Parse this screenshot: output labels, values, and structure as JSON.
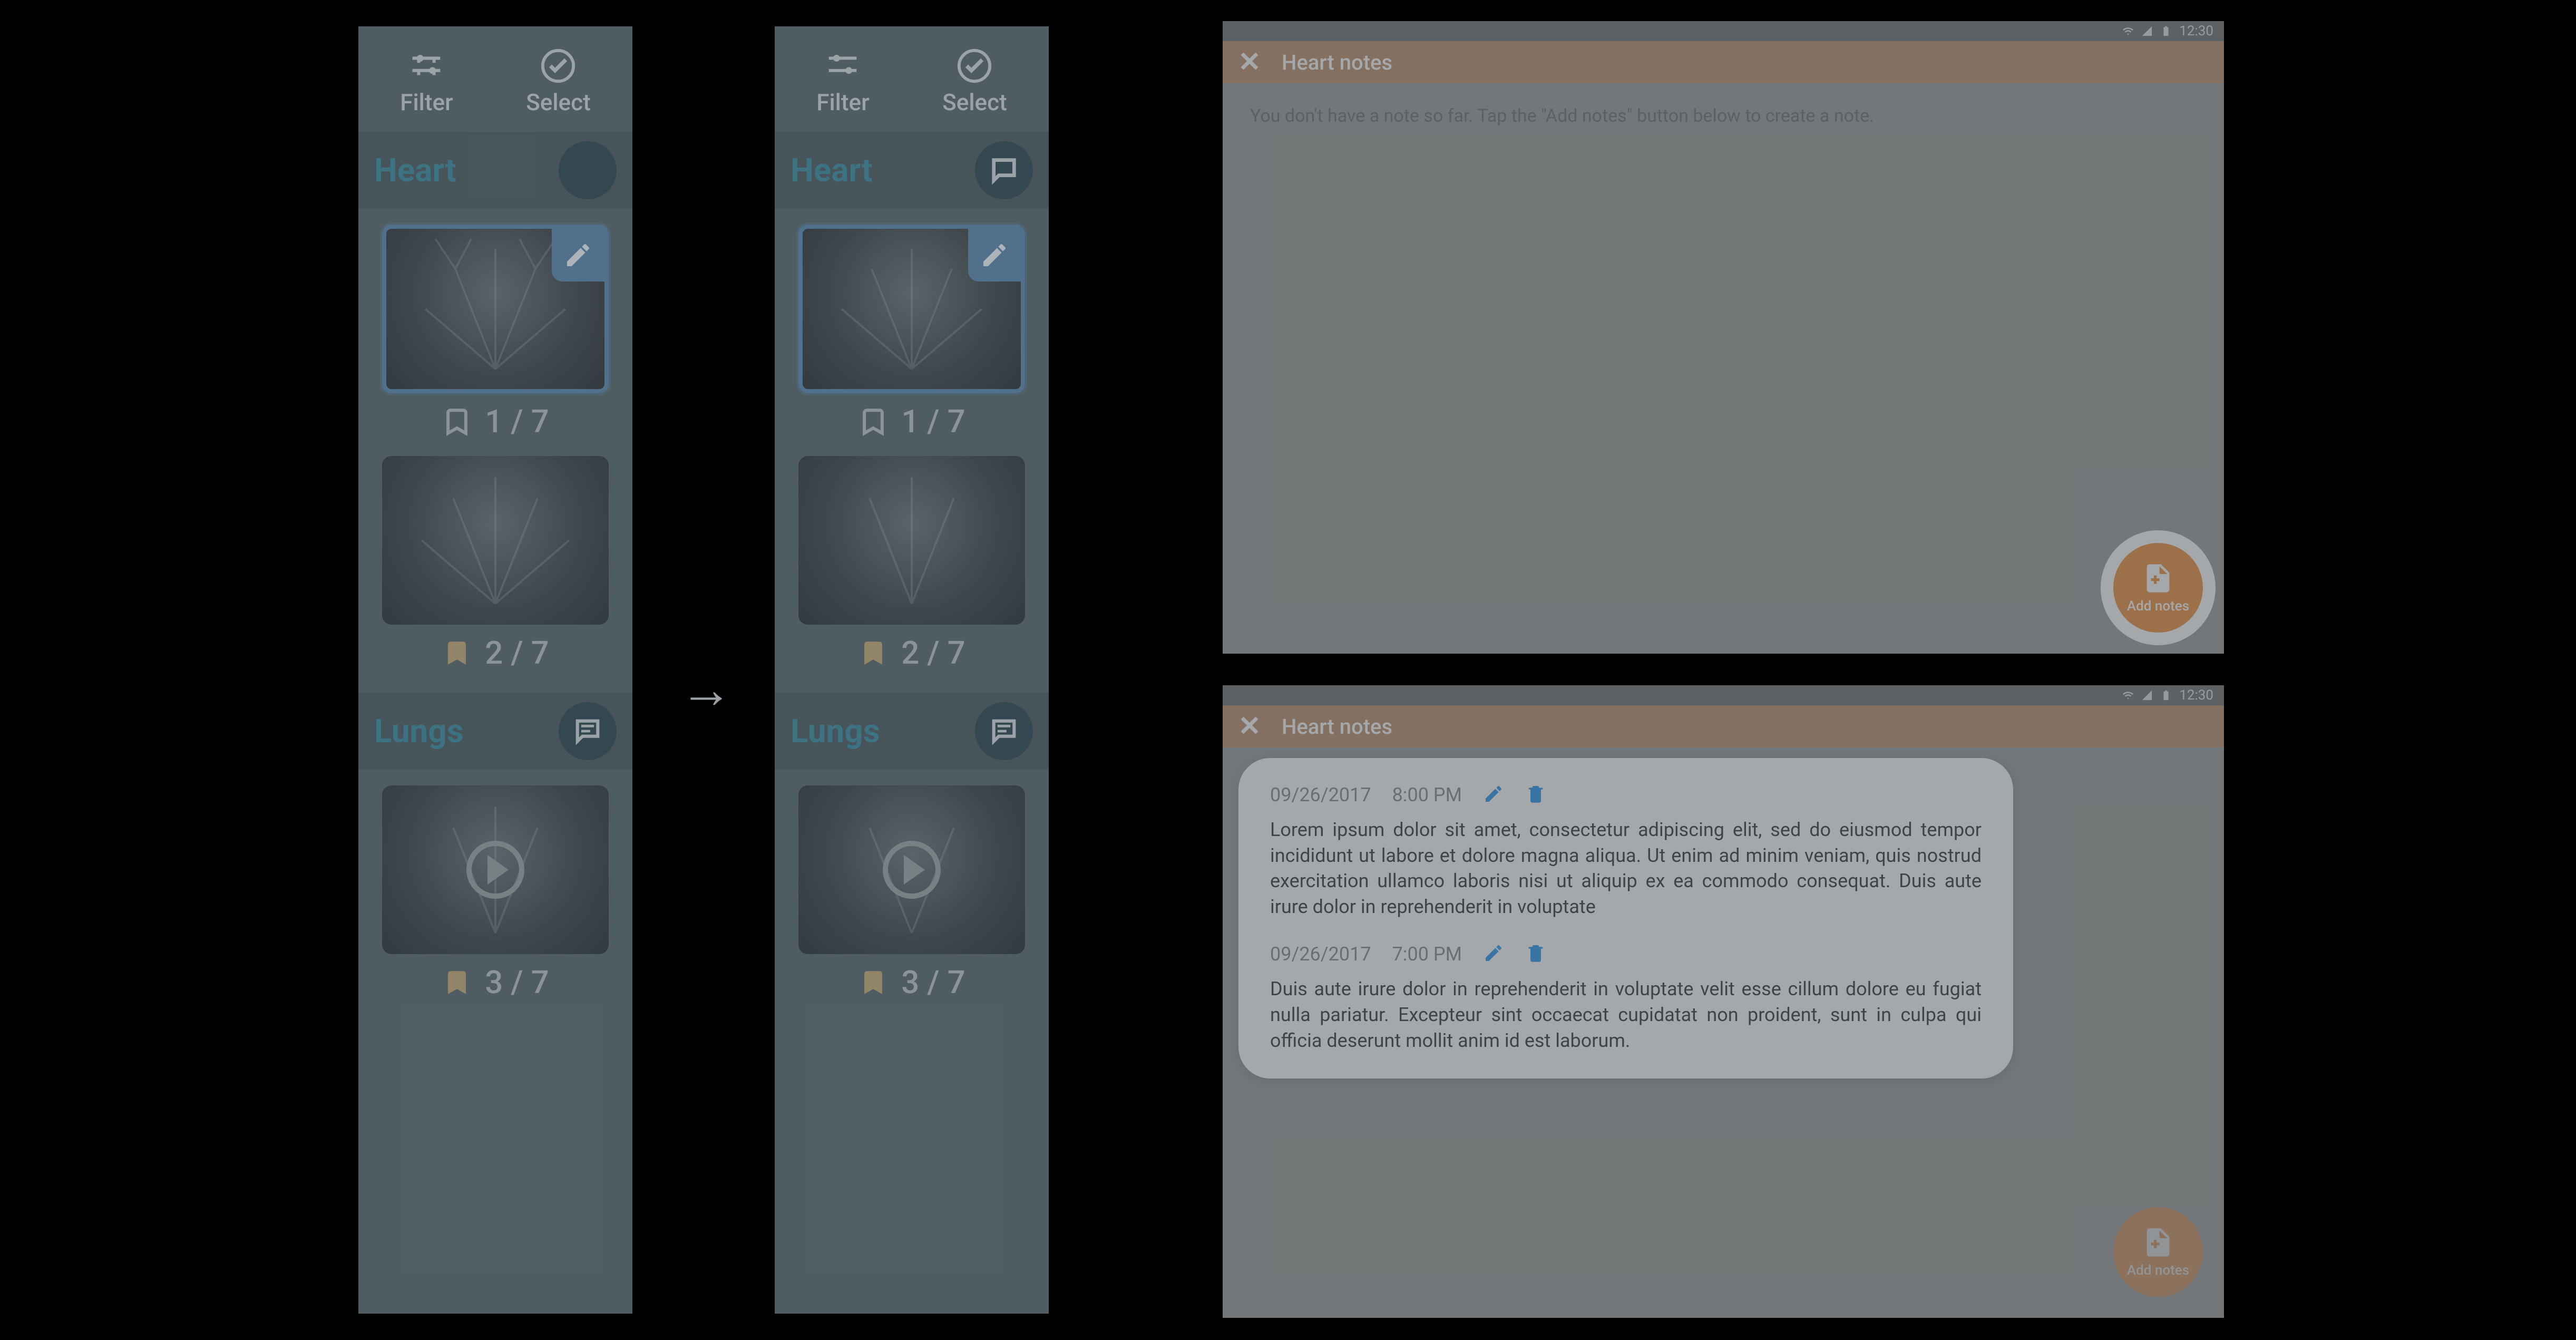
{
  "toolbar": {
    "filter_label": "Filter",
    "select_label": "Select"
  },
  "sections": {
    "heart": {
      "title": "Heart"
    },
    "lungs": {
      "title": "Lungs"
    }
  },
  "counters": {
    "c1": "1 / 7",
    "c2": "2 / 7",
    "c3": "3 / 7"
  },
  "statusbar": {
    "time": "12:30"
  },
  "notes_screen": {
    "title": "Heart notes",
    "empty_message": "You don't have a note so far. Tap the \"Add notes\" button below to create a note.",
    "fab_label": "Add notes"
  },
  "notes": [
    {
      "date": "09/26/2017",
      "time": "8:00 PM",
      "body": "Lorem ipsum dolor sit amet, consectetur adipiscing elit, sed do eiusmod tempor incididunt ut labore et dolore magna aliqua. Ut enim ad minim veniam, quis nostrud exercitation ullamco laboris nisi ut aliquip ex ea commodo consequat. Duis aute irure dolor in reprehenderit in voluptate"
    },
    {
      "date": "09/26/2017",
      "time": "7:00 PM",
      "body": "Duis aute irure dolor in reprehenderit in voluptate velit esse cillum dolore eu fugiat nulla pariatur. Excepteur sint occaecat cupidatat non proident, sunt in culpa qui officia deserunt mollit anim id est laborum."
    }
  ]
}
